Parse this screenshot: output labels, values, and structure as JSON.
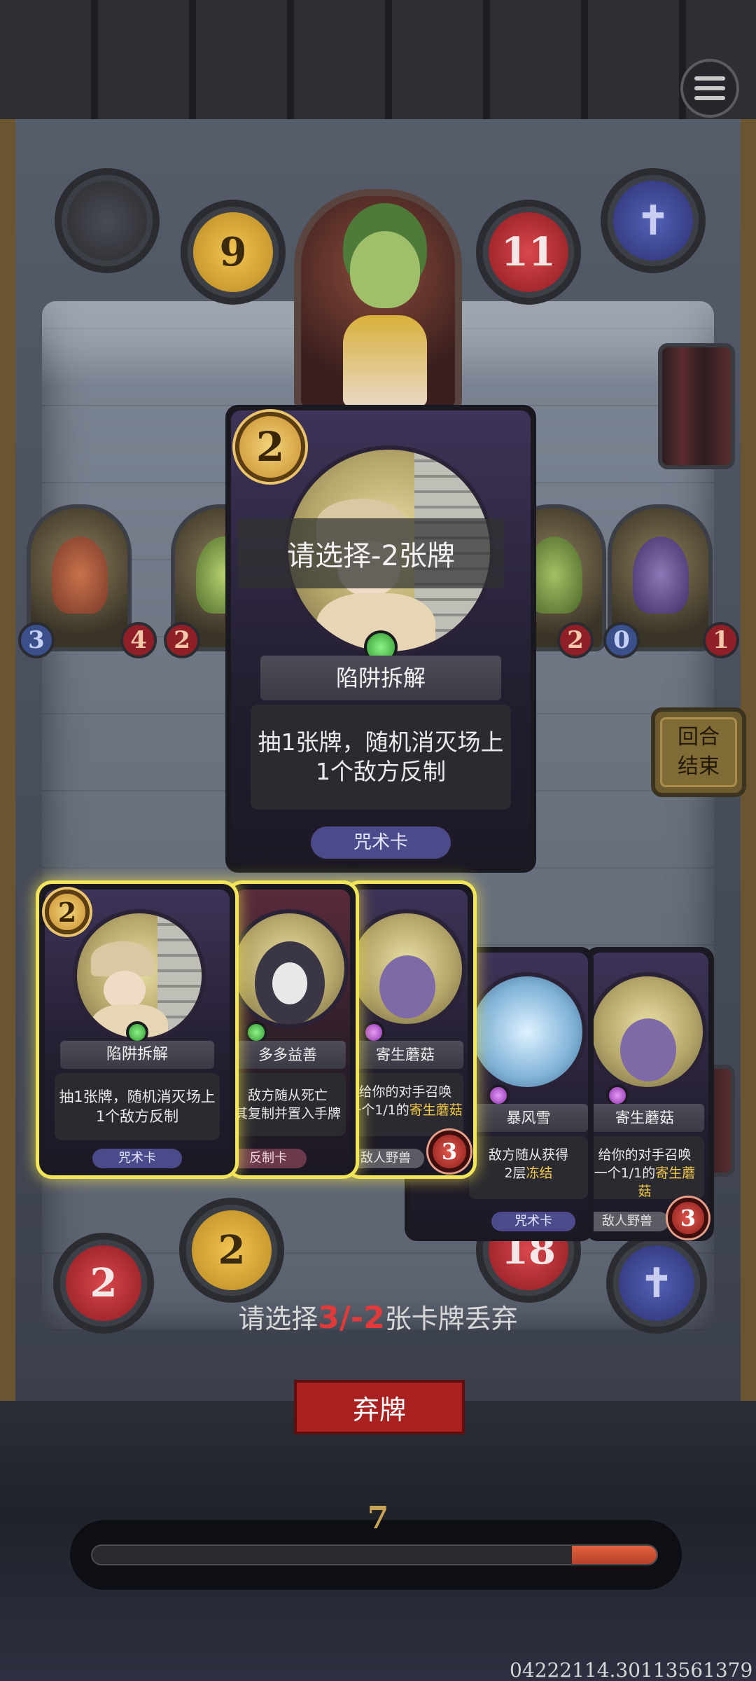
{
  "hud": {
    "gold": "9",
    "health": "11",
    "menu_icon": "menu-icon",
    "lower_gold": "2",
    "lower_red": "2",
    "lower_health": "18"
  },
  "enemy_board": [
    {
      "attack": "3",
      "health": "4"
    },
    {
      "attack": "2",
      "health": ""
    },
    {
      "attack": "",
      "health": "2"
    },
    {
      "attack": "0",
      "health": "1"
    }
  ],
  "end_turn": {
    "label": "回合\n结束"
  },
  "preview_card": {
    "cost": "2",
    "overlay": "请选择-2张牌",
    "name": "陷阱拆解",
    "description": "抽1张牌，随机消灭场上1个敌方反制",
    "type": "咒术卡"
  },
  "hand": [
    {
      "cost": "2",
      "name": "陷阱拆解",
      "description": "抽1张牌，随机消灭场上1个敌方反制",
      "type": "咒术卡",
      "selected": true
    },
    {
      "name": "多多益善",
      "description": "敌方随从死亡\n其复制并置入手牌",
      "type": "反制卡",
      "selected": true
    },
    {
      "name": "寄生蘑菇",
      "description_a": "给你的对手召唤\n一个1/1的",
      "description_hl": "寄生蘑菇",
      "type": "敌人野兽",
      "cost_bottom": "3",
      "selected": true
    },
    {
      "name": "暴风雪",
      "description_a": "敌方随从获得\n2层",
      "description_hl": "冻结",
      "type": "咒术卡",
      "selected": false
    },
    {
      "name": "寄生蘑菇",
      "description_a": "给你的对手召唤\n一个1/1的",
      "description_hl": "寄生蘑菇",
      "type": "敌人野兽",
      "cost_bottom": "3",
      "selected": false
    }
  ],
  "prompt": {
    "before": "请选择",
    "numbers": "3/-2",
    "after": "张卡牌丢弃"
  },
  "discard_button": "弃牌",
  "timer": {
    "value": "7",
    "progress": 0.15
  },
  "version": "04222114.30113561379"
}
